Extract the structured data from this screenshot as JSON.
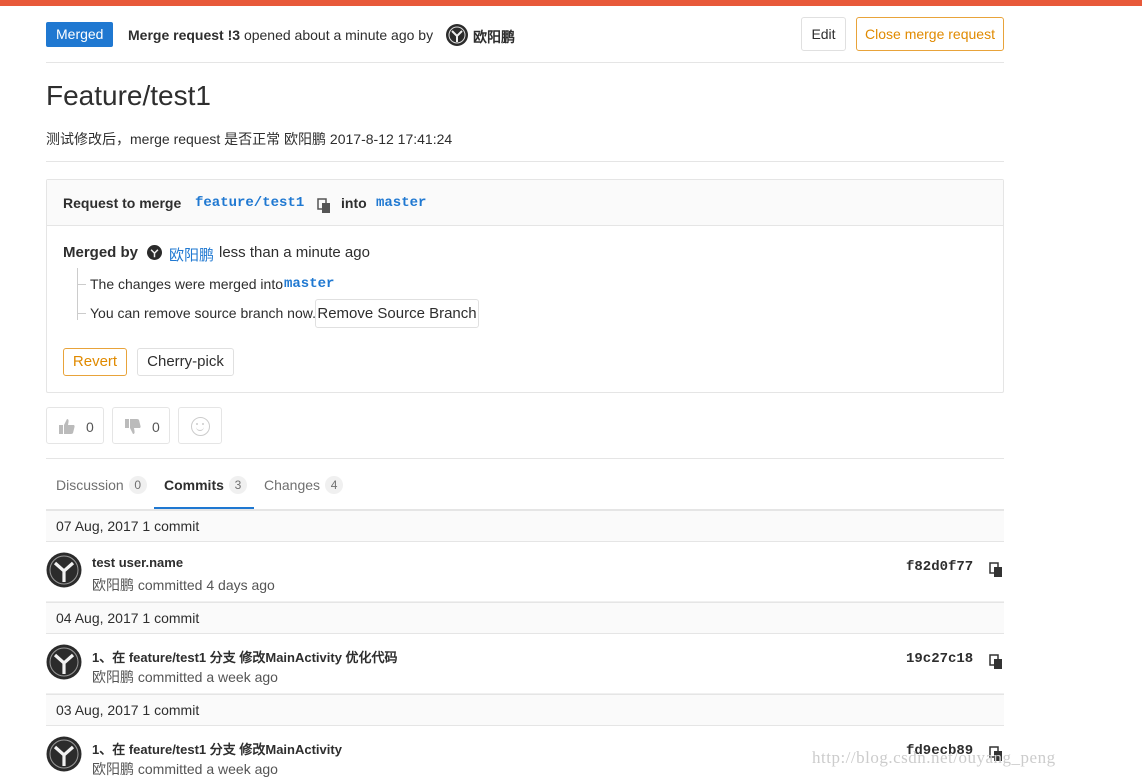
{
  "header": {
    "status_badge": "Merged",
    "mr_ref": "Merge request !3",
    "opened_text": "opened about a minute ago by",
    "author": "欧阳鹏",
    "edit_label": "Edit",
    "close_label": "Close merge request"
  },
  "title": "Feature/test1",
  "description": "测试修改后，merge request 是否正常 欧阳鹏 2017-8-12 17:41:24",
  "widget": {
    "request_to_merge": "Request to merge",
    "source_branch": "feature/test1",
    "into": "into",
    "target_branch": "master",
    "merged_by_label": "Merged by",
    "merged_by_author": "欧阳鹏",
    "merged_time": "less than a minute ago",
    "changes_merged_text": "The changes were merged into",
    "changes_merged_branch": "master",
    "remove_text": "You can remove source branch now.",
    "remove_button": "Remove Source Branch",
    "revert_button": "Revert",
    "cherry_pick_button": "Cherry-pick"
  },
  "awards": {
    "thumbs_up_count": "0",
    "thumbs_down_count": "0"
  },
  "tabs": [
    {
      "label": "Discussion",
      "count": "0"
    },
    {
      "label": "Commits",
      "count": "3"
    },
    {
      "label": "Changes",
      "count": "4"
    }
  ],
  "commit_groups": [
    {
      "date": "07 Aug, 2017",
      "count_label": "1 commit",
      "commit": {
        "title": "test user.name",
        "meta": "欧阳鹏 committed 4 days ago",
        "sha": "f82d0f77"
      }
    },
    {
      "date": "04 Aug, 2017",
      "count_label": "1 commit",
      "commit": {
        "title": "1、在 feature/test1 分支 修改MainActivity 优化代码",
        "meta": "欧阳鹏 committed a week ago",
        "sha": "19c27c18"
      }
    },
    {
      "date": "03 Aug, 2017",
      "count_label": "1 commit",
      "commit": {
        "title": "1、在 feature/test1 分支 修改MainActivity",
        "meta": "欧阳鹏 committed a week ago",
        "sha": "fd9ecb89"
      }
    }
  ],
  "watermark": "http://blog.csdn.net/ouyang_peng",
  "colors": {
    "accent": "#1f78d1",
    "topbar": "#e8593a",
    "warning": "#e08a00"
  }
}
